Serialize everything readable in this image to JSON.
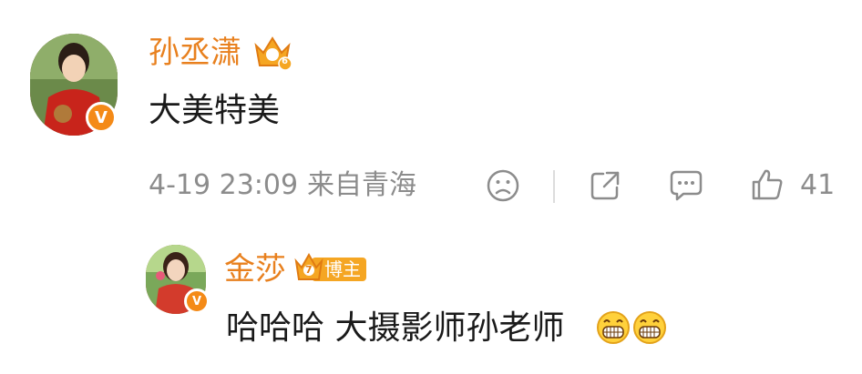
{
  "comment": {
    "username": "孙丞潇",
    "level": "6",
    "text": "大美特美",
    "time": "4-19 23:09",
    "source": "来自青海",
    "verified_mark": "V",
    "like_count": "41"
  },
  "reply": {
    "username": "金莎",
    "level": "7",
    "badge_label": "博主",
    "verified_mark": "V",
    "text": "哈哈哈 大摄影师孙老师",
    "emojis": [
      "grin-emoji",
      "grin-emoji"
    ]
  },
  "colors": {
    "username": "#e8801e",
    "text": "#1a1a1a",
    "meta": "#8c8c8c",
    "badge": "#f5a623",
    "verified": "#f48a17"
  },
  "icons": [
    "sad-face-icon",
    "share-icon",
    "comment-icon",
    "like-icon",
    "crown-icon"
  ]
}
